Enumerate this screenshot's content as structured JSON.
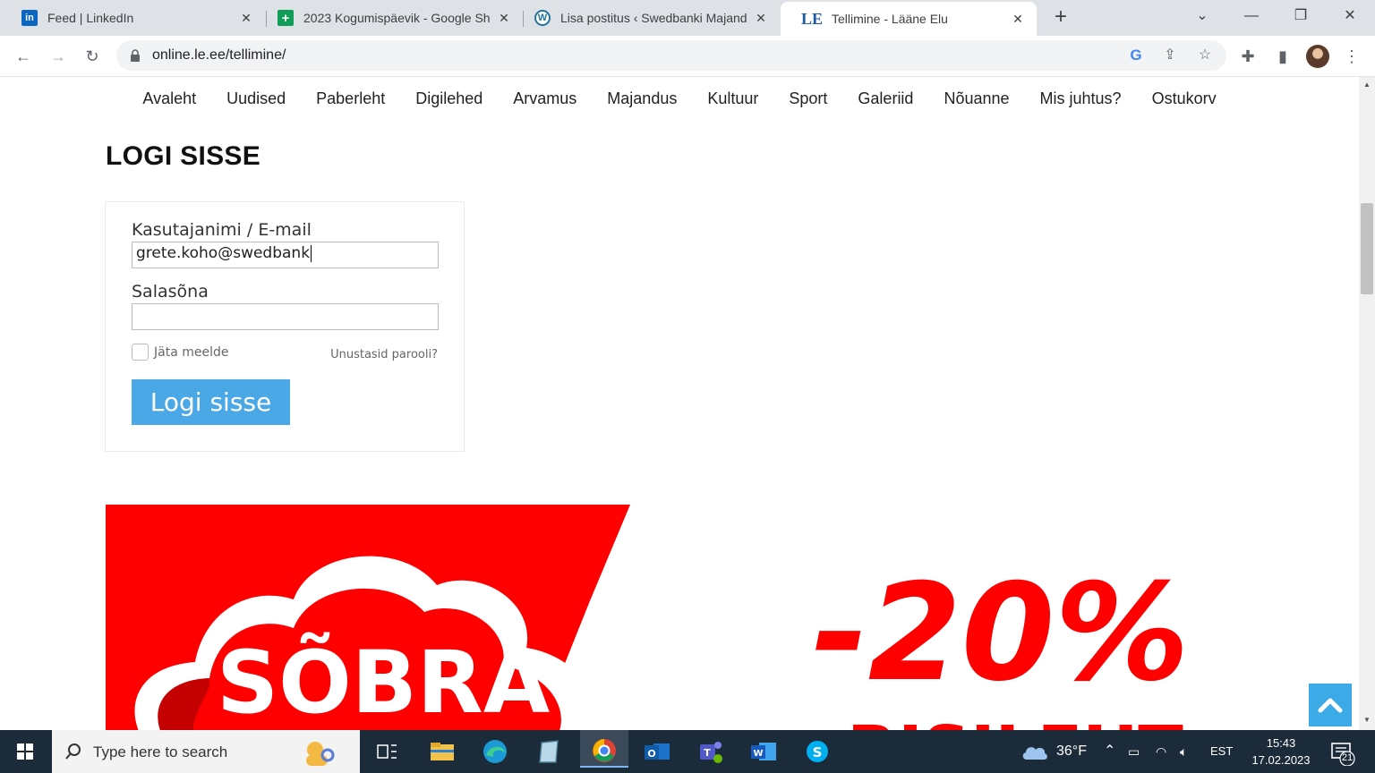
{
  "browser": {
    "tabs": [
      {
        "title": "Feed | LinkedIn",
        "icon": "linkedin-icon",
        "close": "✕"
      },
      {
        "title": "2023 Kogumispäevik - Google Sh",
        "icon": "google-sheets-icon",
        "close": "✕"
      },
      {
        "title": "Lisa postitus ‹ Swedbanki Majand",
        "icon": "wordpress-icon",
        "close": "✕"
      },
      {
        "title": "Tellimine - Lääne Elu",
        "icon": "lane-elu-icon",
        "close": "✕",
        "favicon_text": "LE"
      }
    ],
    "new_tab": "+",
    "url": "online.le.ee/tellimine/"
  },
  "site": {
    "nav": [
      "Avaleht",
      "Uudised",
      "Paberleht",
      "Digilehed",
      "Arvamus",
      "Majandus",
      "Kultuur",
      "Sport",
      "Galeriid",
      "Nõuanne",
      "Mis juhtus?",
      "Ostukorv"
    ]
  },
  "login": {
    "title": "LOGI SISSE",
    "username_label": "Kasutajanimi / E-mail",
    "username_value": "grete.koho@swedbank",
    "password_label": "Salasõna",
    "password_value": "",
    "remember_label": "Jäta meelde",
    "remember_checked": false,
    "forgot_link": "Unustasid parooli?",
    "submit_label": "Logi sisse"
  },
  "banner": {
    "headline": "SÕBRA-",
    "discount": "-20%",
    "partial_text": "RISILEHT",
    "bg_color": "#ff0000"
  },
  "taskbar": {
    "search_placeholder": "Type here to search",
    "weather": "36°F",
    "language": "EST",
    "time": "15:43",
    "date": "17.02.2023",
    "notifications": "21"
  },
  "colors": {
    "accent_blue": "#4aa8e6",
    "banner_red": "#ff0000"
  }
}
